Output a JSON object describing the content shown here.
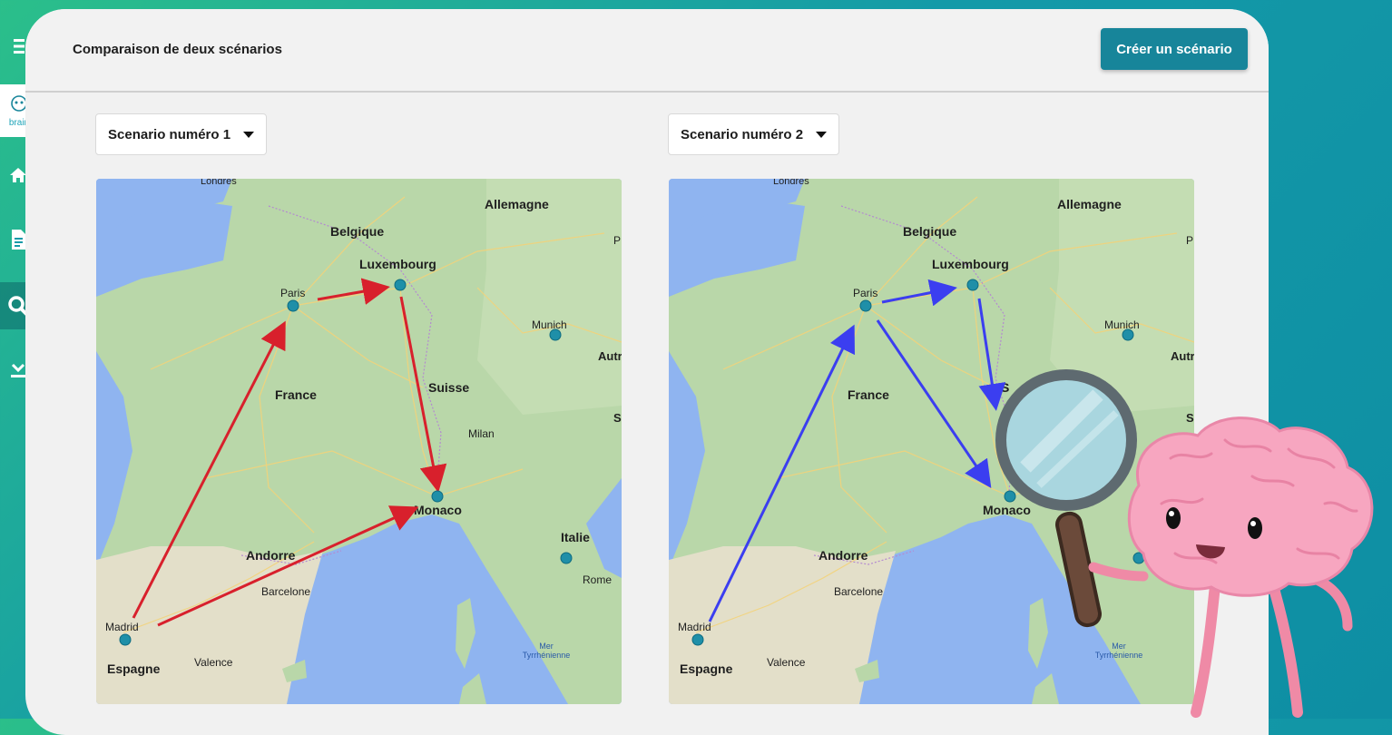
{
  "header": {
    "title": "Comparaison de deux scénarios",
    "create_button": "Créer un scénario"
  },
  "sidebar": {
    "logo_text": "brain",
    "icons": [
      "menu-icon",
      "home-icon",
      "document-icon",
      "search-icon",
      "download-icon"
    ]
  },
  "scenarios": [
    {
      "select_label": "Scenario numéro 1",
      "route_color": "#d8202c"
    },
    {
      "select_label": "Scenario numéro 2",
      "route_color": "#3b3ef0"
    }
  ],
  "map": {
    "labels": {
      "londres": "Londres",
      "allemagne": "Allemagne",
      "belgique": "Belgique",
      "luxembourg": "Luxembourg",
      "paris": "Paris",
      "munich": "Munich",
      "autriche": "Autr",
      "france": "France",
      "suisse": "Suisse",
      "milan": "Milan",
      "monaco": "Monaco",
      "italie": "Italie",
      "rome": "Rome",
      "andorre": "Andorre",
      "barcelone": "Barcelone",
      "madrid": "Madrid",
      "espagne": "Espagne",
      "valence": "Valence",
      "mer": "Mer",
      "tyrrhenienne": "Tyrrhénienne",
      "p": "P",
      "s": "S",
      "it": "It",
      "sl": "Sl"
    }
  }
}
